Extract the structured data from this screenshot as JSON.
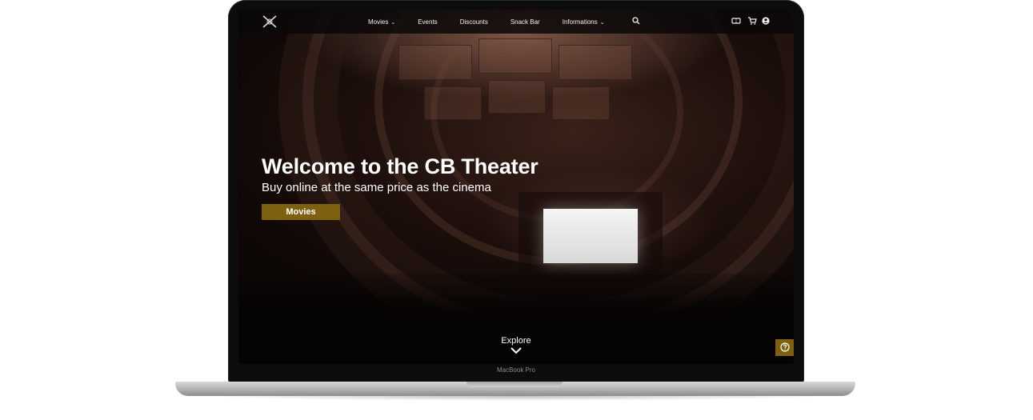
{
  "device": {
    "label": "MacBook Pro"
  },
  "nav": {
    "logo_icon": "cinema-logo",
    "items": [
      {
        "label": "Movies",
        "has_dropdown": true
      },
      {
        "label": "Events",
        "has_dropdown": false
      },
      {
        "label": "Discounts",
        "has_dropdown": false
      },
      {
        "label": "Snack Bar",
        "has_dropdown": false
      },
      {
        "label": "Informations",
        "has_dropdown": true
      }
    ],
    "icons": [
      "search-icon",
      "ticket-icon",
      "cart-icon",
      "user-icon"
    ]
  },
  "hero": {
    "title": "Welcome to the CB Theater",
    "subtitle": "Buy online at the same price as the cinema",
    "button_label": "Movies"
  },
  "explore": {
    "label": "Explore"
  },
  "help": {
    "icon": "help-icon"
  },
  "colors": {
    "accent": "#7d6110",
    "nav_bg": "#0a0808"
  }
}
